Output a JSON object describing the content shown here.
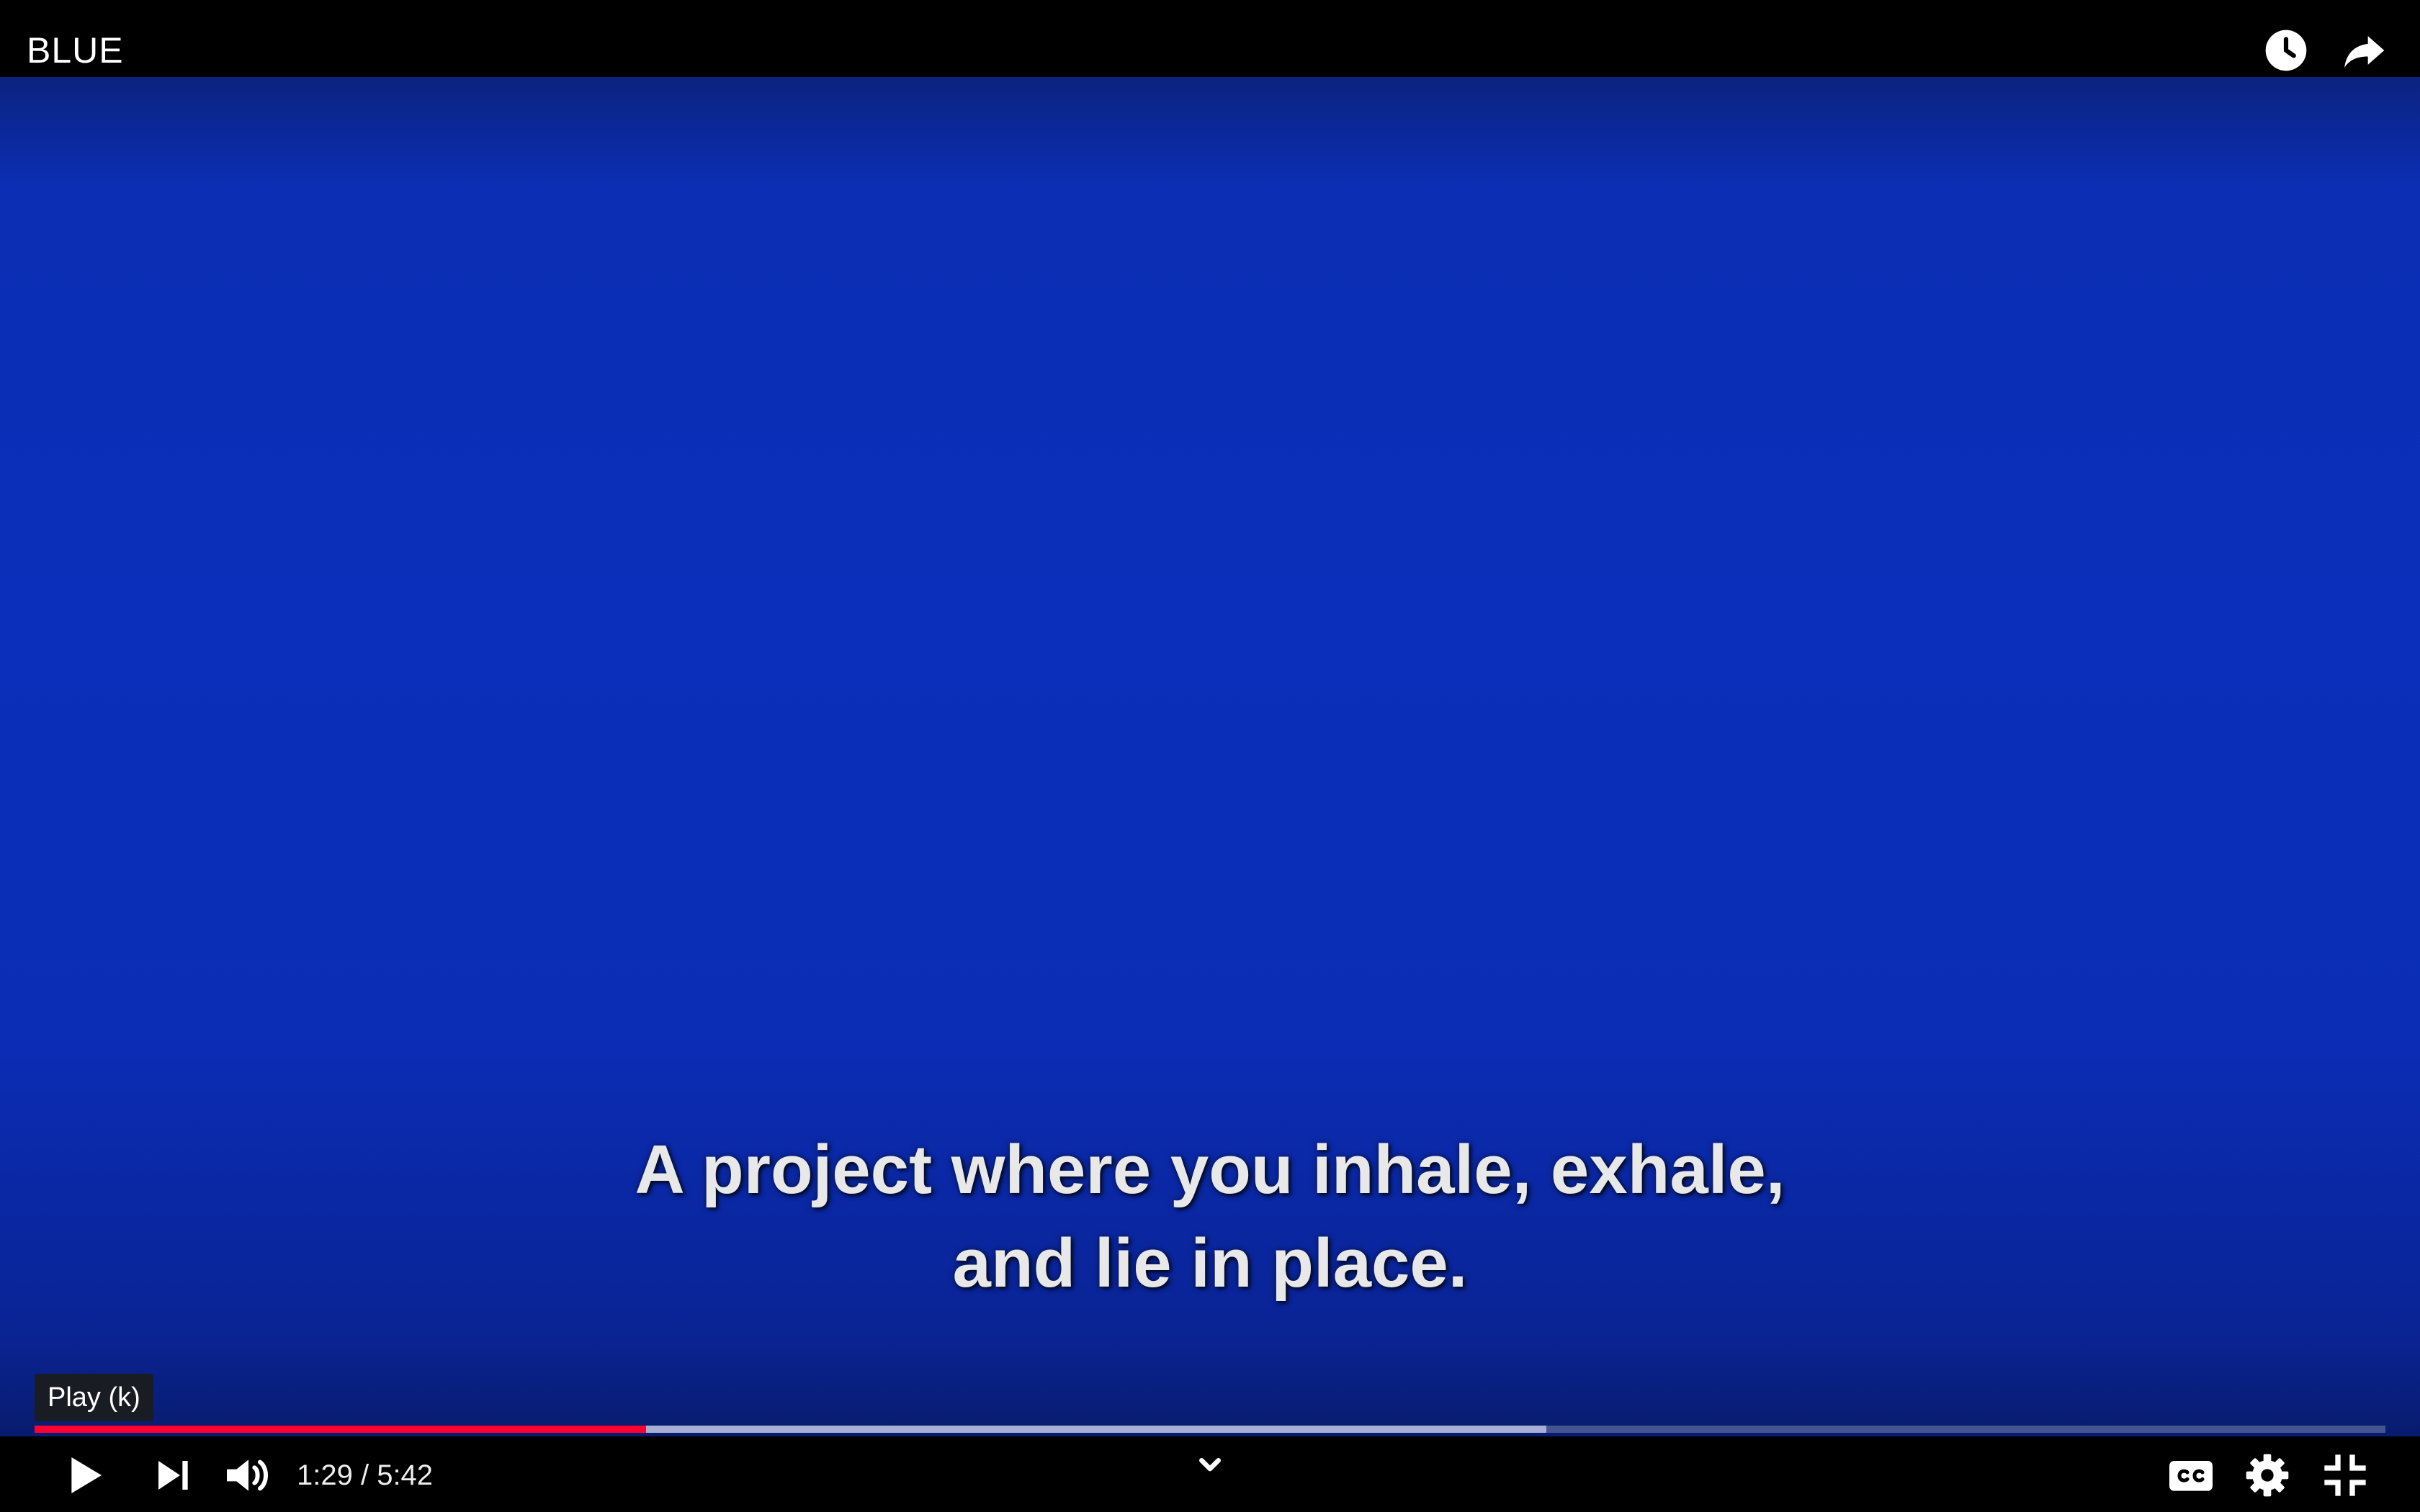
{
  "header": {
    "title": "BLUE",
    "watch_later_icon": "clock-icon",
    "share_icon": "share-arrow-icon"
  },
  "video": {
    "background_color": "#0b2fba"
  },
  "captions": {
    "line1": "A project where you inhale, exhale,",
    "line2": "and lie in place."
  },
  "tooltip": {
    "text": "Play (k)"
  },
  "progress": {
    "played_fraction": 0.26,
    "buffered_fraction": 0.643,
    "played_color": "#ff0033"
  },
  "controls": {
    "current_time": "1:29",
    "duration": "5:42",
    "time_display": "1:29 / 5:42",
    "icons": [
      "play-icon",
      "next-icon",
      "volume-icon",
      "chevron-down-icon",
      "captions-icon",
      "settings-icon",
      "exit-fullscreen-icon"
    ]
  }
}
